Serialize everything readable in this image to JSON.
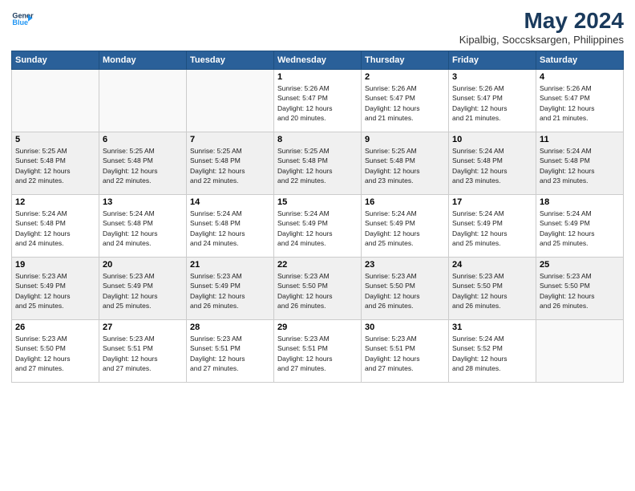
{
  "logo": {
    "line1": "General",
    "line2": "Blue",
    "arrow_color": "#2196F3"
  },
  "title": "May 2024",
  "subtitle": "Kipalbig, Soccsksargen, Philippines",
  "days_of_week": [
    "Sunday",
    "Monday",
    "Tuesday",
    "Wednesday",
    "Thursday",
    "Friday",
    "Saturday"
  ],
  "weeks": [
    [
      {
        "day": "",
        "info": ""
      },
      {
        "day": "",
        "info": ""
      },
      {
        "day": "",
        "info": ""
      },
      {
        "day": "1",
        "info": "Sunrise: 5:26 AM\nSunset: 5:47 PM\nDaylight: 12 hours\nand 20 minutes."
      },
      {
        "day": "2",
        "info": "Sunrise: 5:26 AM\nSunset: 5:47 PM\nDaylight: 12 hours\nand 21 minutes."
      },
      {
        "day": "3",
        "info": "Sunrise: 5:26 AM\nSunset: 5:47 PM\nDaylight: 12 hours\nand 21 minutes."
      },
      {
        "day": "4",
        "info": "Sunrise: 5:26 AM\nSunset: 5:47 PM\nDaylight: 12 hours\nand 21 minutes."
      }
    ],
    [
      {
        "day": "5",
        "info": "Sunrise: 5:25 AM\nSunset: 5:48 PM\nDaylight: 12 hours\nand 22 minutes."
      },
      {
        "day": "6",
        "info": "Sunrise: 5:25 AM\nSunset: 5:48 PM\nDaylight: 12 hours\nand 22 minutes."
      },
      {
        "day": "7",
        "info": "Sunrise: 5:25 AM\nSunset: 5:48 PM\nDaylight: 12 hours\nand 22 minutes."
      },
      {
        "day": "8",
        "info": "Sunrise: 5:25 AM\nSunset: 5:48 PM\nDaylight: 12 hours\nand 22 minutes."
      },
      {
        "day": "9",
        "info": "Sunrise: 5:25 AM\nSunset: 5:48 PM\nDaylight: 12 hours\nand 23 minutes."
      },
      {
        "day": "10",
        "info": "Sunrise: 5:24 AM\nSunset: 5:48 PM\nDaylight: 12 hours\nand 23 minutes."
      },
      {
        "day": "11",
        "info": "Sunrise: 5:24 AM\nSunset: 5:48 PM\nDaylight: 12 hours\nand 23 minutes."
      }
    ],
    [
      {
        "day": "12",
        "info": "Sunrise: 5:24 AM\nSunset: 5:48 PM\nDaylight: 12 hours\nand 24 minutes."
      },
      {
        "day": "13",
        "info": "Sunrise: 5:24 AM\nSunset: 5:48 PM\nDaylight: 12 hours\nand 24 minutes."
      },
      {
        "day": "14",
        "info": "Sunrise: 5:24 AM\nSunset: 5:48 PM\nDaylight: 12 hours\nand 24 minutes."
      },
      {
        "day": "15",
        "info": "Sunrise: 5:24 AM\nSunset: 5:49 PM\nDaylight: 12 hours\nand 24 minutes."
      },
      {
        "day": "16",
        "info": "Sunrise: 5:24 AM\nSunset: 5:49 PM\nDaylight: 12 hours\nand 25 minutes."
      },
      {
        "day": "17",
        "info": "Sunrise: 5:24 AM\nSunset: 5:49 PM\nDaylight: 12 hours\nand 25 minutes."
      },
      {
        "day": "18",
        "info": "Sunrise: 5:24 AM\nSunset: 5:49 PM\nDaylight: 12 hours\nand 25 minutes."
      }
    ],
    [
      {
        "day": "19",
        "info": "Sunrise: 5:23 AM\nSunset: 5:49 PM\nDaylight: 12 hours\nand 25 minutes."
      },
      {
        "day": "20",
        "info": "Sunrise: 5:23 AM\nSunset: 5:49 PM\nDaylight: 12 hours\nand 25 minutes."
      },
      {
        "day": "21",
        "info": "Sunrise: 5:23 AM\nSunset: 5:49 PM\nDaylight: 12 hours\nand 26 minutes."
      },
      {
        "day": "22",
        "info": "Sunrise: 5:23 AM\nSunset: 5:50 PM\nDaylight: 12 hours\nand 26 minutes."
      },
      {
        "day": "23",
        "info": "Sunrise: 5:23 AM\nSunset: 5:50 PM\nDaylight: 12 hours\nand 26 minutes."
      },
      {
        "day": "24",
        "info": "Sunrise: 5:23 AM\nSunset: 5:50 PM\nDaylight: 12 hours\nand 26 minutes."
      },
      {
        "day": "25",
        "info": "Sunrise: 5:23 AM\nSunset: 5:50 PM\nDaylight: 12 hours\nand 26 minutes."
      }
    ],
    [
      {
        "day": "26",
        "info": "Sunrise: 5:23 AM\nSunset: 5:50 PM\nDaylight: 12 hours\nand 27 minutes."
      },
      {
        "day": "27",
        "info": "Sunrise: 5:23 AM\nSunset: 5:51 PM\nDaylight: 12 hours\nand 27 minutes."
      },
      {
        "day": "28",
        "info": "Sunrise: 5:23 AM\nSunset: 5:51 PM\nDaylight: 12 hours\nand 27 minutes."
      },
      {
        "day": "29",
        "info": "Sunrise: 5:23 AM\nSunset: 5:51 PM\nDaylight: 12 hours\nand 27 minutes."
      },
      {
        "day": "30",
        "info": "Sunrise: 5:23 AM\nSunset: 5:51 PM\nDaylight: 12 hours\nand 27 minutes."
      },
      {
        "day": "31",
        "info": "Sunrise: 5:24 AM\nSunset: 5:52 PM\nDaylight: 12 hours\nand 28 minutes."
      },
      {
        "day": "",
        "info": ""
      }
    ]
  ]
}
